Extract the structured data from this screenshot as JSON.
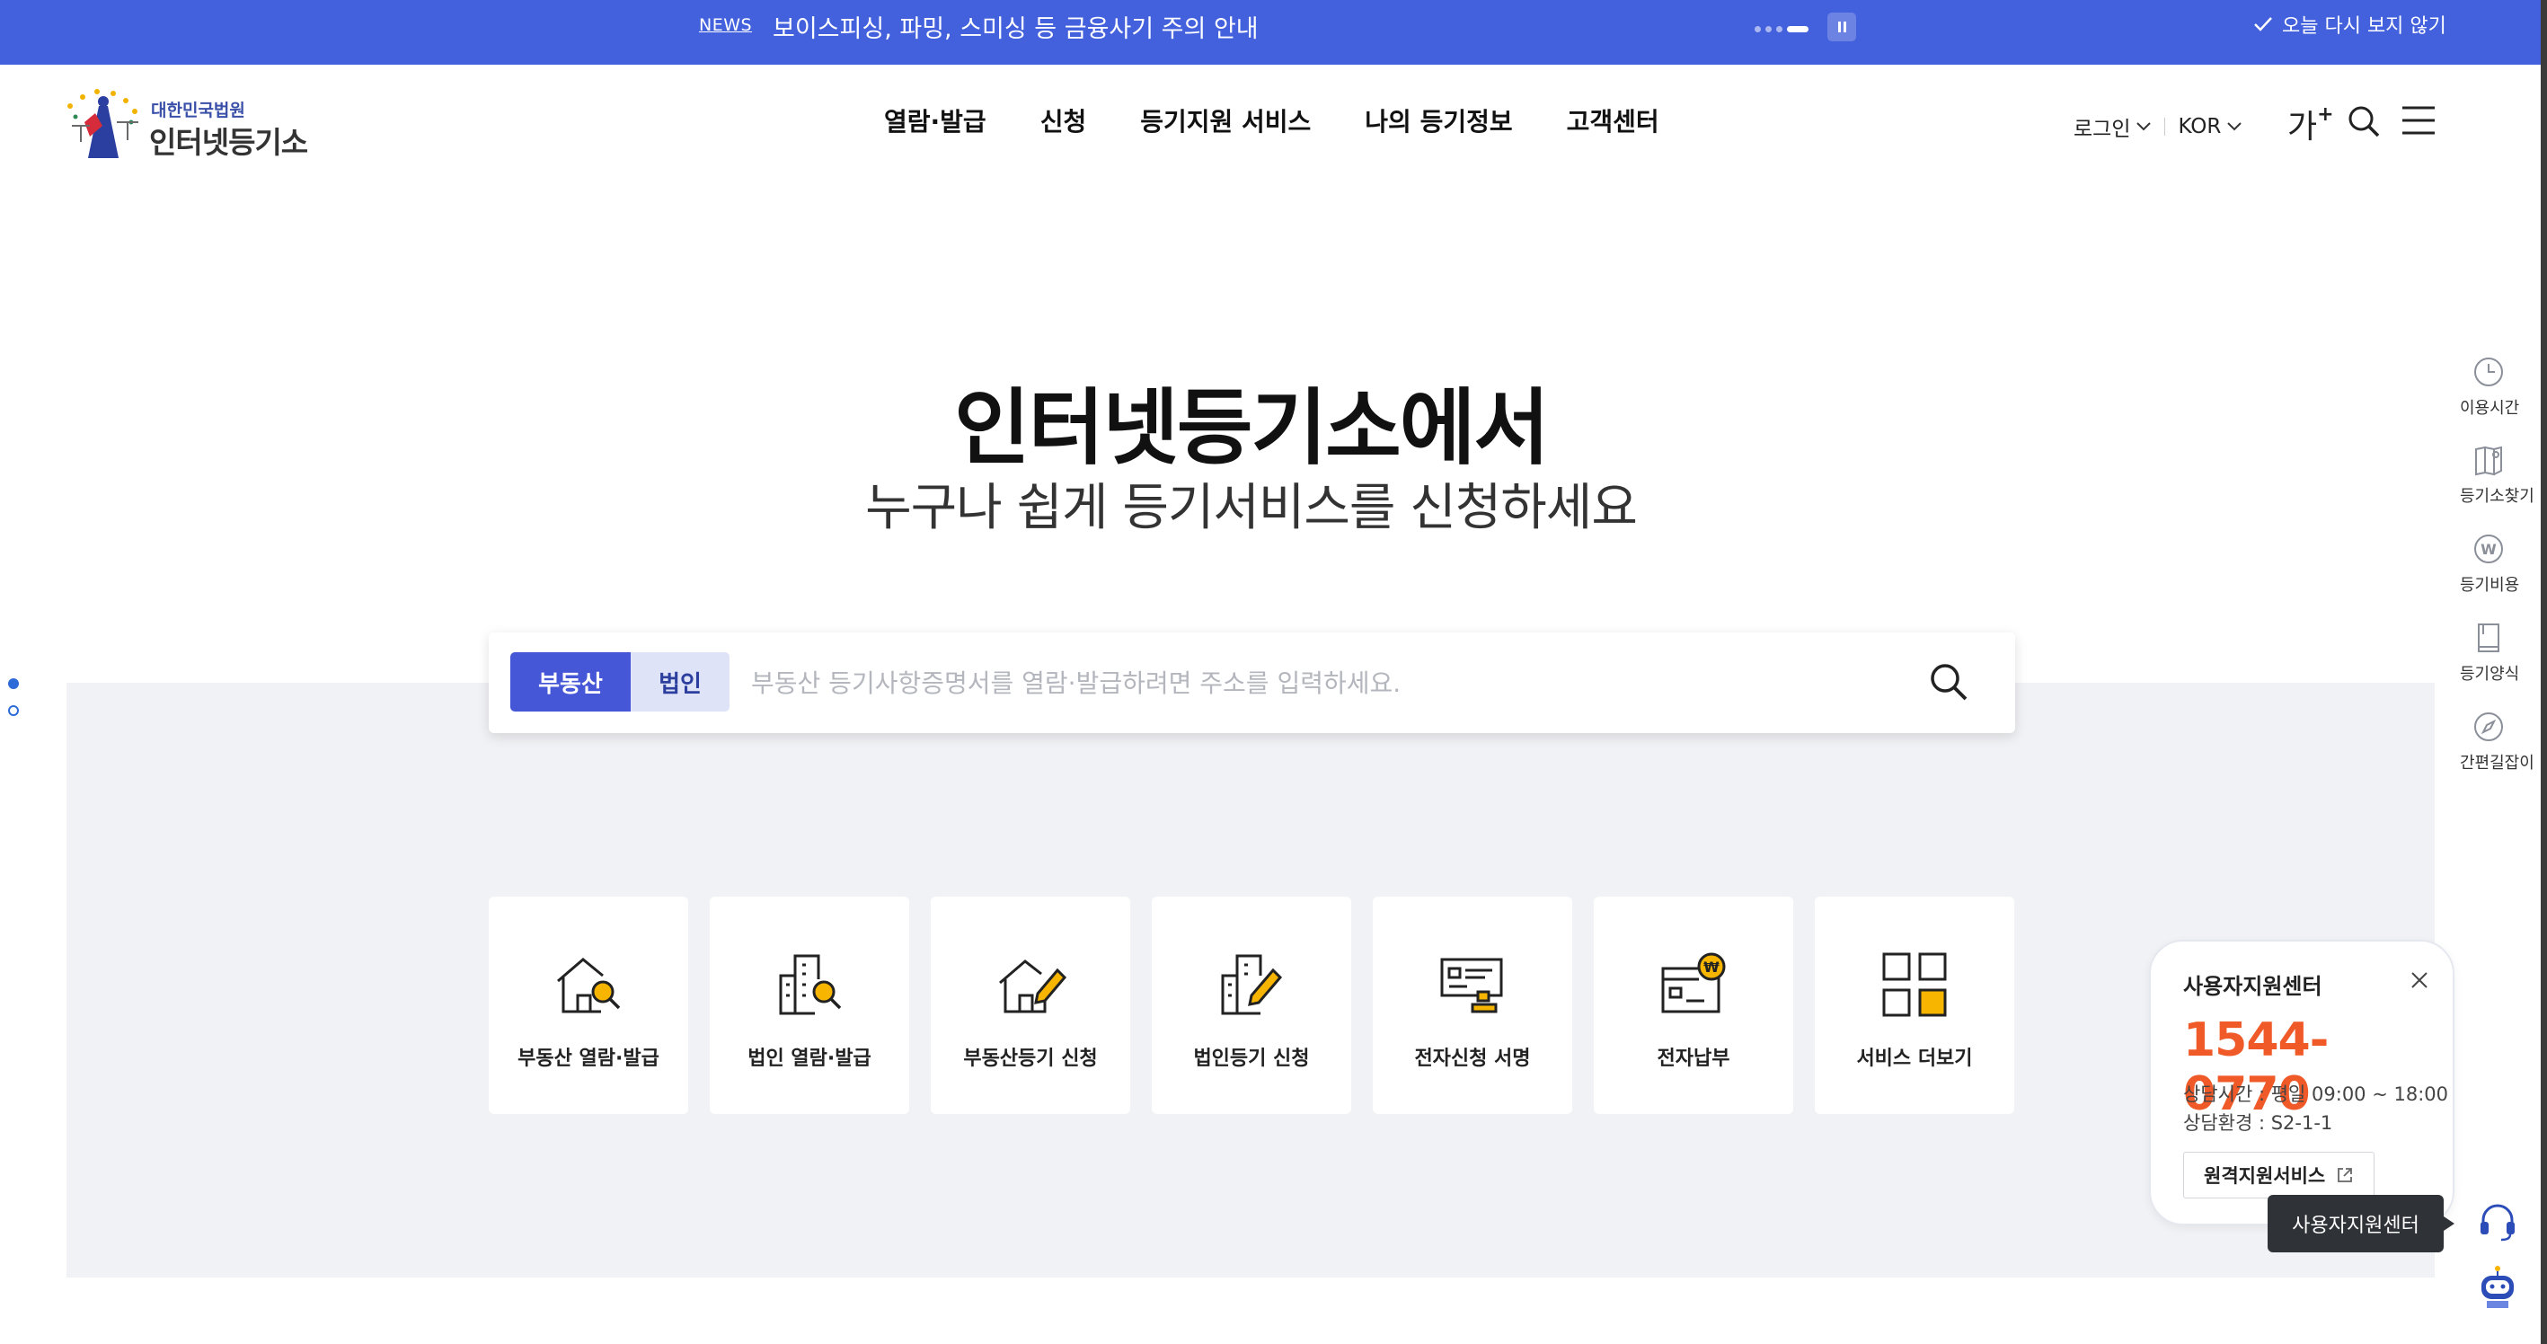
{
  "news": {
    "label": "NEWS",
    "text": "보이스피싱, 파밍, 스미싱 등 금융사기 주의 안내",
    "dismiss_label": "오늘 다시 보지 않기"
  },
  "logo": {
    "sub": "대한민국법원",
    "main": "인터넷등기소"
  },
  "gnb": [
    "열람·발급",
    "신청",
    "등기지원 서비스",
    "나의 등기정보",
    "고객센터"
  ],
  "util": {
    "login_label": "로그인",
    "lang_label": "KOR",
    "font_label": "가",
    "font_plus": "+"
  },
  "hero": {
    "title": "인터넷등기소에서",
    "subtitle": "누구나 쉽게 등기서비스를 신청하세요"
  },
  "search": {
    "tabs": [
      "부동산",
      "법인"
    ],
    "active_tab": "부동산",
    "placeholder": "부동산 등기사항증명서를 열람·발급하려면 주소를 입력하세요.",
    "value": ""
  },
  "cards": [
    {
      "label": "부동산 열람·발급",
      "icon": "house-search-icon"
    },
    {
      "label": "법인 열람·발급",
      "icon": "building-search-icon"
    },
    {
      "label": "부동산등기 신청",
      "icon": "house-edit-icon"
    },
    {
      "label": "법인등기 신청",
      "icon": "building-edit-icon"
    },
    {
      "label": "전자신청 서명",
      "icon": "esign-icon"
    },
    {
      "label": "전자납부",
      "icon": "epayment-icon"
    },
    {
      "label": "서비스 더보기",
      "icon": "grid-more-icon"
    }
  ],
  "quick": [
    {
      "label": "이용시간",
      "icon": "clock-icon"
    },
    {
      "label": "등기소찾기",
      "icon": "map-book-icon"
    },
    {
      "label": "등기비용",
      "icon": "won-coin-icon"
    },
    {
      "label": "등기양식",
      "icon": "form-book-icon"
    },
    {
      "label": "간편길잡이",
      "icon": "compass-icon"
    }
  ],
  "support": {
    "title": "사용자지원센터",
    "phone": "1544-0770",
    "hours": "상담시간 : 평일 09:00 ~ 18:00",
    "env": "상담환경 : S2-1-1",
    "remote_label": "원격지원서비스",
    "tooltip": "사용자지원센터"
  },
  "colors": {
    "banner": "#4361dd",
    "accent": "#4557d6",
    "phone": "#f05a28",
    "icon_highlight": "#f7b500"
  }
}
